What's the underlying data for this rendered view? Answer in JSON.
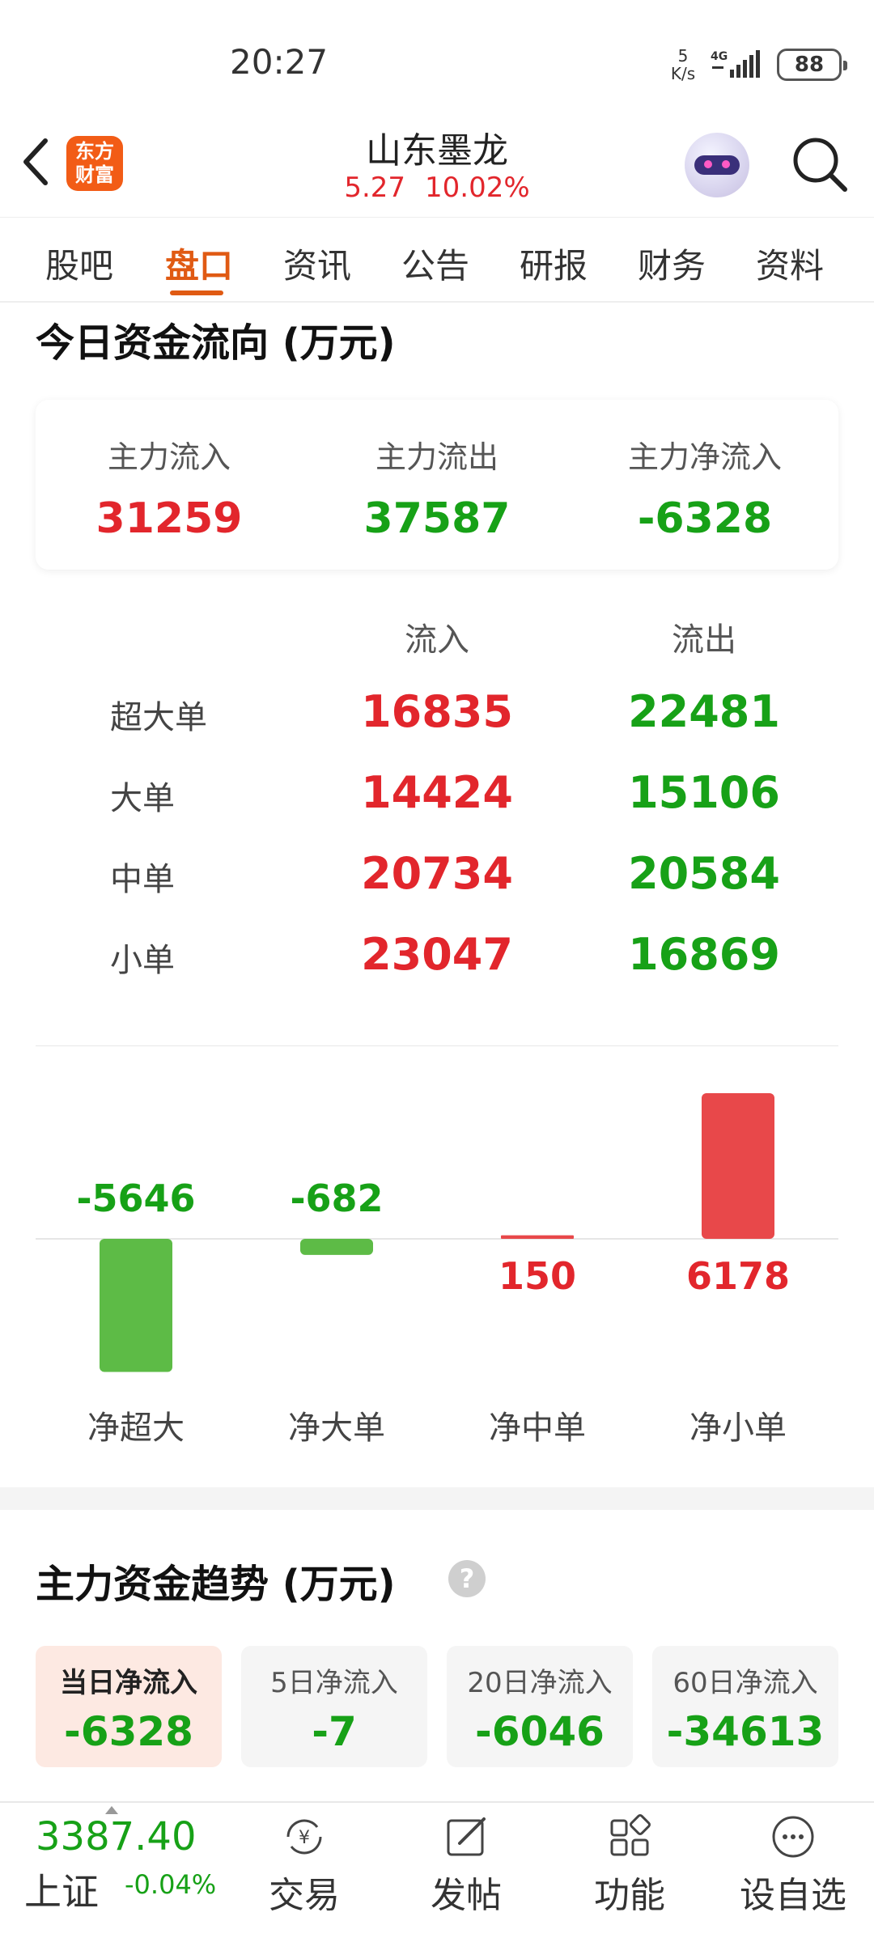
{
  "status_bar": {
    "time": "20:27",
    "net_speed_value": "5",
    "net_speed_unit": "K/s",
    "network": "4G",
    "battery": "88"
  },
  "header": {
    "logo_line1": "东方",
    "logo_line2": "财富",
    "stock_name": "山东墨龙",
    "price": "5.27",
    "change_pct": "10.02%"
  },
  "tabs": [
    {
      "label": "股吧"
    },
    {
      "label": "盘口",
      "active": true
    },
    {
      "label": "资讯"
    },
    {
      "label": "公告"
    },
    {
      "label": "研报"
    },
    {
      "label": "财务"
    },
    {
      "label": "资料"
    }
  ],
  "fund_flow": {
    "title": "今日资金流向 (万元)",
    "summary": {
      "inflow_label": "主力流入",
      "inflow_value": "31259",
      "outflow_label": "主力流出",
      "outflow_value": "37587",
      "net_label": "主力净流入",
      "net_value": "-6328"
    },
    "grid": {
      "in_header": "流入",
      "out_header": "流出",
      "rows": [
        {
          "label": "超大单",
          "in": "16835",
          "out": "22481"
        },
        {
          "label": "大单",
          "in": "14424",
          "out": "15106"
        },
        {
          "label": "中单",
          "in": "20734",
          "out": "20584"
        },
        {
          "label": "小单",
          "in": "23047",
          "out": "16869"
        }
      ]
    }
  },
  "chart_data": {
    "type": "bar",
    "categories": [
      "净超大",
      "净大单",
      "净中单",
      "净小单"
    ],
    "values": [
      -5646,
      -682,
      150,
      6178
    ],
    "positive_color": "#e8484a",
    "negative_color": "#5dbb46"
  },
  "trend": {
    "title": "主力资金趋势 (万元)",
    "help_glyph": "?",
    "items": [
      {
        "label": "当日净流入",
        "value": "-6328",
        "active": true
      },
      {
        "label": "5日净流入",
        "value": "-7"
      },
      {
        "label": "20日净流入",
        "value": "-6046"
      },
      {
        "label": "60日净流入",
        "value": "-34613"
      }
    ]
  },
  "bottom_bar": {
    "index_value": "3387.40",
    "index_name": "上证",
    "index_change": "-0.04%",
    "nav": [
      {
        "label": "交易",
        "icon": "trade-icon"
      },
      {
        "label": "发帖",
        "icon": "post-icon"
      },
      {
        "label": "功能",
        "icon": "apps-icon"
      },
      {
        "label": "设自选",
        "icon": "more-icon"
      }
    ]
  },
  "colors": {
    "up": "#e2262c",
    "down": "#17a117",
    "accent": "#e05a13"
  }
}
